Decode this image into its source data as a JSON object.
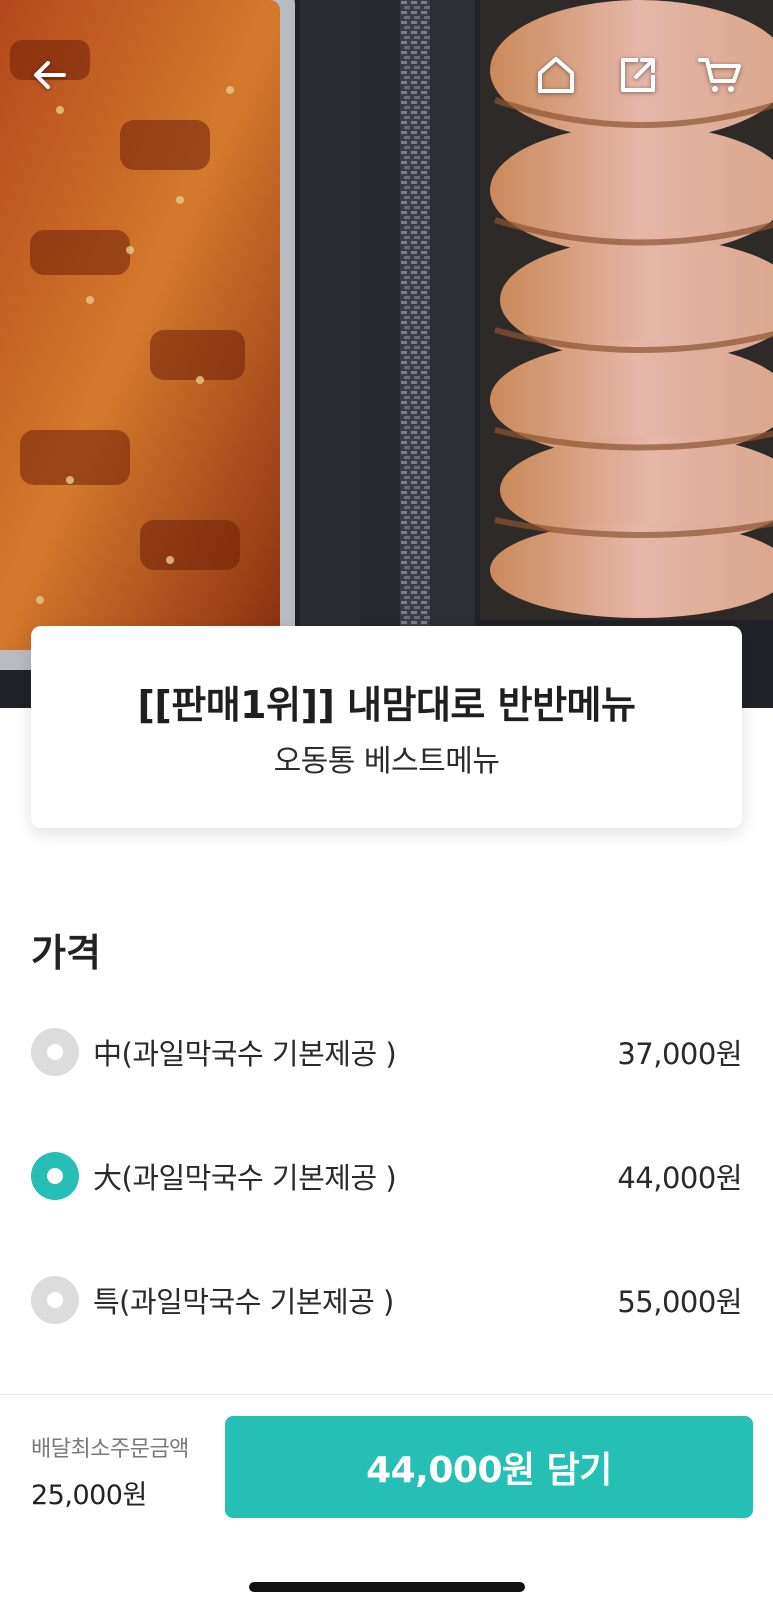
{
  "header": {
    "back_icon": "arrow-left-icon",
    "home_icon": "home-icon",
    "share_icon": "share-icon",
    "cart_icon": "cart-icon"
  },
  "product": {
    "title": "[[판매1위]] 내맘대로 반반메뉴",
    "subtitle": "오동통 베스트메뉴"
  },
  "price_section": {
    "title": "가격",
    "options": [
      {
        "label": "中(과일막국수 기본제공 )",
        "price": "37,000원",
        "selected": false
      },
      {
        "label": "大(과일막국수 기본제공 )",
        "price": "44,000원",
        "selected": true
      },
      {
        "label": "특(과일막국수 기본제공 )",
        "price": "55,000원",
        "selected": false
      }
    ]
  },
  "footer": {
    "min_order_label": "배달최소주문금액",
    "min_order_value": "25,000원",
    "add_button_label": "44,000원 담기"
  },
  "colors": {
    "accent": "#26bfb5",
    "radio_unselected": "#dcdcdc"
  }
}
